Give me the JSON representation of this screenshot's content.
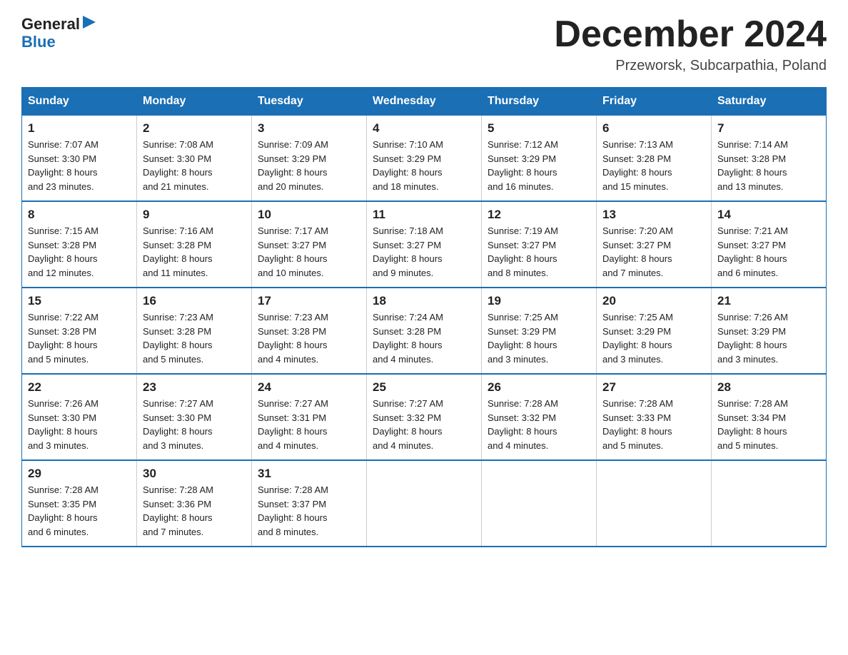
{
  "logo": {
    "general": "General",
    "blue": "Blue"
  },
  "header": {
    "title": "December 2024",
    "location": "Przeworsk, Subcarpathia, Poland"
  },
  "days_of_week": [
    "Sunday",
    "Monday",
    "Tuesday",
    "Wednesday",
    "Thursday",
    "Friday",
    "Saturday"
  ],
  "weeks": [
    [
      {
        "day": "1",
        "info": "Sunrise: 7:07 AM\nSunset: 3:30 PM\nDaylight: 8 hours\nand 23 minutes."
      },
      {
        "day": "2",
        "info": "Sunrise: 7:08 AM\nSunset: 3:30 PM\nDaylight: 8 hours\nand 21 minutes."
      },
      {
        "day": "3",
        "info": "Sunrise: 7:09 AM\nSunset: 3:29 PM\nDaylight: 8 hours\nand 20 minutes."
      },
      {
        "day": "4",
        "info": "Sunrise: 7:10 AM\nSunset: 3:29 PM\nDaylight: 8 hours\nand 18 minutes."
      },
      {
        "day": "5",
        "info": "Sunrise: 7:12 AM\nSunset: 3:29 PM\nDaylight: 8 hours\nand 16 minutes."
      },
      {
        "day": "6",
        "info": "Sunrise: 7:13 AM\nSunset: 3:28 PM\nDaylight: 8 hours\nand 15 minutes."
      },
      {
        "day": "7",
        "info": "Sunrise: 7:14 AM\nSunset: 3:28 PM\nDaylight: 8 hours\nand 13 minutes."
      }
    ],
    [
      {
        "day": "8",
        "info": "Sunrise: 7:15 AM\nSunset: 3:28 PM\nDaylight: 8 hours\nand 12 minutes."
      },
      {
        "day": "9",
        "info": "Sunrise: 7:16 AM\nSunset: 3:28 PM\nDaylight: 8 hours\nand 11 minutes."
      },
      {
        "day": "10",
        "info": "Sunrise: 7:17 AM\nSunset: 3:27 PM\nDaylight: 8 hours\nand 10 minutes."
      },
      {
        "day": "11",
        "info": "Sunrise: 7:18 AM\nSunset: 3:27 PM\nDaylight: 8 hours\nand 9 minutes."
      },
      {
        "day": "12",
        "info": "Sunrise: 7:19 AM\nSunset: 3:27 PM\nDaylight: 8 hours\nand 8 minutes."
      },
      {
        "day": "13",
        "info": "Sunrise: 7:20 AM\nSunset: 3:27 PM\nDaylight: 8 hours\nand 7 minutes."
      },
      {
        "day": "14",
        "info": "Sunrise: 7:21 AM\nSunset: 3:27 PM\nDaylight: 8 hours\nand 6 minutes."
      }
    ],
    [
      {
        "day": "15",
        "info": "Sunrise: 7:22 AM\nSunset: 3:28 PM\nDaylight: 8 hours\nand 5 minutes."
      },
      {
        "day": "16",
        "info": "Sunrise: 7:23 AM\nSunset: 3:28 PM\nDaylight: 8 hours\nand 5 minutes."
      },
      {
        "day": "17",
        "info": "Sunrise: 7:23 AM\nSunset: 3:28 PM\nDaylight: 8 hours\nand 4 minutes."
      },
      {
        "day": "18",
        "info": "Sunrise: 7:24 AM\nSunset: 3:28 PM\nDaylight: 8 hours\nand 4 minutes."
      },
      {
        "day": "19",
        "info": "Sunrise: 7:25 AM\nSunset: 3:29 PM\nDaylight: 8 hours\nand 3 minutes."
      },
      {
        "day": "20",
        "info": "Sunrise: 7:25 AM\nSunset: 3:29 PM\nDaylight: 8 hours\nand 3 minutes."
      },
      {
        "day": "21",
        "info": "Sunrise: 7:26 AM\nSunset: 3:29 PM\nDaylight: 8 hours\nand 3 minutes."
      }
    ],
    [
      {
        "day": "22",
        "info": "Sunrise: 7:26 AM\nSunset: 3:30 PM\nDaylight: 8 hours\nand 3 minutes."
      },
      {
        "day": "23",
        "info": "Sunrise: 7:27 AM\nSunset: 3:30 PM\nDaylight: 8 hours\nand 3 minutes."
      },
      {
        "day": "24",
        "info": "Sunrise: 7:27 AM\nSunset: 3:31 PM\nDaylight: 8 hours\nand 4 minutes."
      },
      {
        "day": "25",
        "info": "Sunrise: 7:27 AM\nSunset: 3:32 PM\nDaylight: 8 hours\nand 4 minutes."
      },
      {
        "day": "26",
        "info": "Sunrise: 7:28 AM\nSunset: 3:32 PM\nDaylight: 8 hours\nand 4 minutes."
      },
      {
        "day": "27",
        "info": "Sunrise: 7:28 AM\nSunset: 3:33 PM\nDaylight: 8 hours\nand 5 minutes."
      },
      {
        "day": "28",
        "info": "Sunrise: 7:28 AM\nSunset: 3:34 PM\nDaylight: 8 hours\nand 5 minutes."
      }
    ],
    [
      {
        "day": "29",
        "info": "Sunrise: 7:28 AM\nSunset: 3:35 PM\nDaylight: 8 hours\nand 6 minutes."
      },
      {
        "day": "30",
        "info": "Sunrise: 7:28 AM\nSunset: 3:36 PM\nDaylight: 8 hours\nand 7 minutes."
      },
      {
        "day": "31",
        "info": "Sunrise: 7:28 AM\nSunset: 3:37 PM\nDaylight: 8 hours\nand 8 minutes."
      },
      {
        "day": "",
        "info": ""
      },
      {
        "day": "",
        "info": ""
      },
      {
        "day": "",
        "info": ""
      },
      {
        "day": "",
        "info": ""
      }
    ]
  ]
}
